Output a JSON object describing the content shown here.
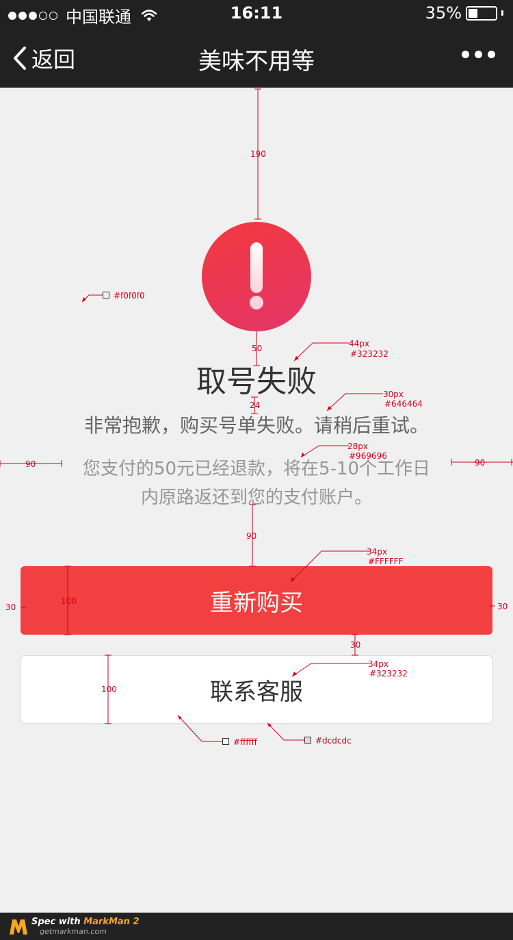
{
  "status_bar": {
    "signal_filled": 3,
    "signal_total": 5,
    "carrier": "中国联通",
    "time": "16:11",
    "battery_text": "35%",
    "battery_level": 0.35
  },
  "nav": {
    "back_label": "返回",
    "title": "美味不用等",
    "more_icon": "ellipsis-icon"
  },
  "result": {
    "icon": "exclamation-icon",
    "icon_gradient": [
      "#f3383d",
      "#e33669"
    ],
    "title": "取号失败",
    "subtitle": "非常抱歉，购买号单失败。请稍后重试。",
    "description_line1": "您支付的50元已经退款，将在5-10个工作日",
    "description_line2": "内原路返还到您的支付账户。"
  },
  "buttons": {
    "primary_label": "重新购买",
    "secondary_label": "联系客服"
  },
  "annotations": {
    "bg_color": "#f0f0f0",
    "top_gap": "190",
    "icon_gap": "50",
    "title_size": "44px",
    "title_color": "#323232",
    "title_gap": "24",
    "subtitle_size": "30px",
    "subtitle_color": "#646464",
    "desc_size": "28px",
    "desc_color": "#969696",
    "side_margin_left": "90",
    "side_margin_right": "90",
    "desc_gap": "90",
    "primary_text_size": "34px",
    "primary_text_color": "#FFFFFF",
    "primary_height": "100",
    "btn_margin_left": "30",
    "btn_margin_right": "30",
    "btn_gap": "30",
    "secondary_text_size": "34px",
    "secondary_text_color": "#323232",
    "secondary_height": "100",
    "secondary_bg": "#ffffff",
    "secondary_border": "#dcdcdc",
    "colors": {
      "primary_button": "#f23f40",
      "nav_bg": "#212121",
      "page_bg": "#f0f0f0"
    }
  },
  "footer": {
    "prefix": "Spec with ",
    "brand": "MarkMan 2",
    "site": "getmarkman.com"
  }
}
